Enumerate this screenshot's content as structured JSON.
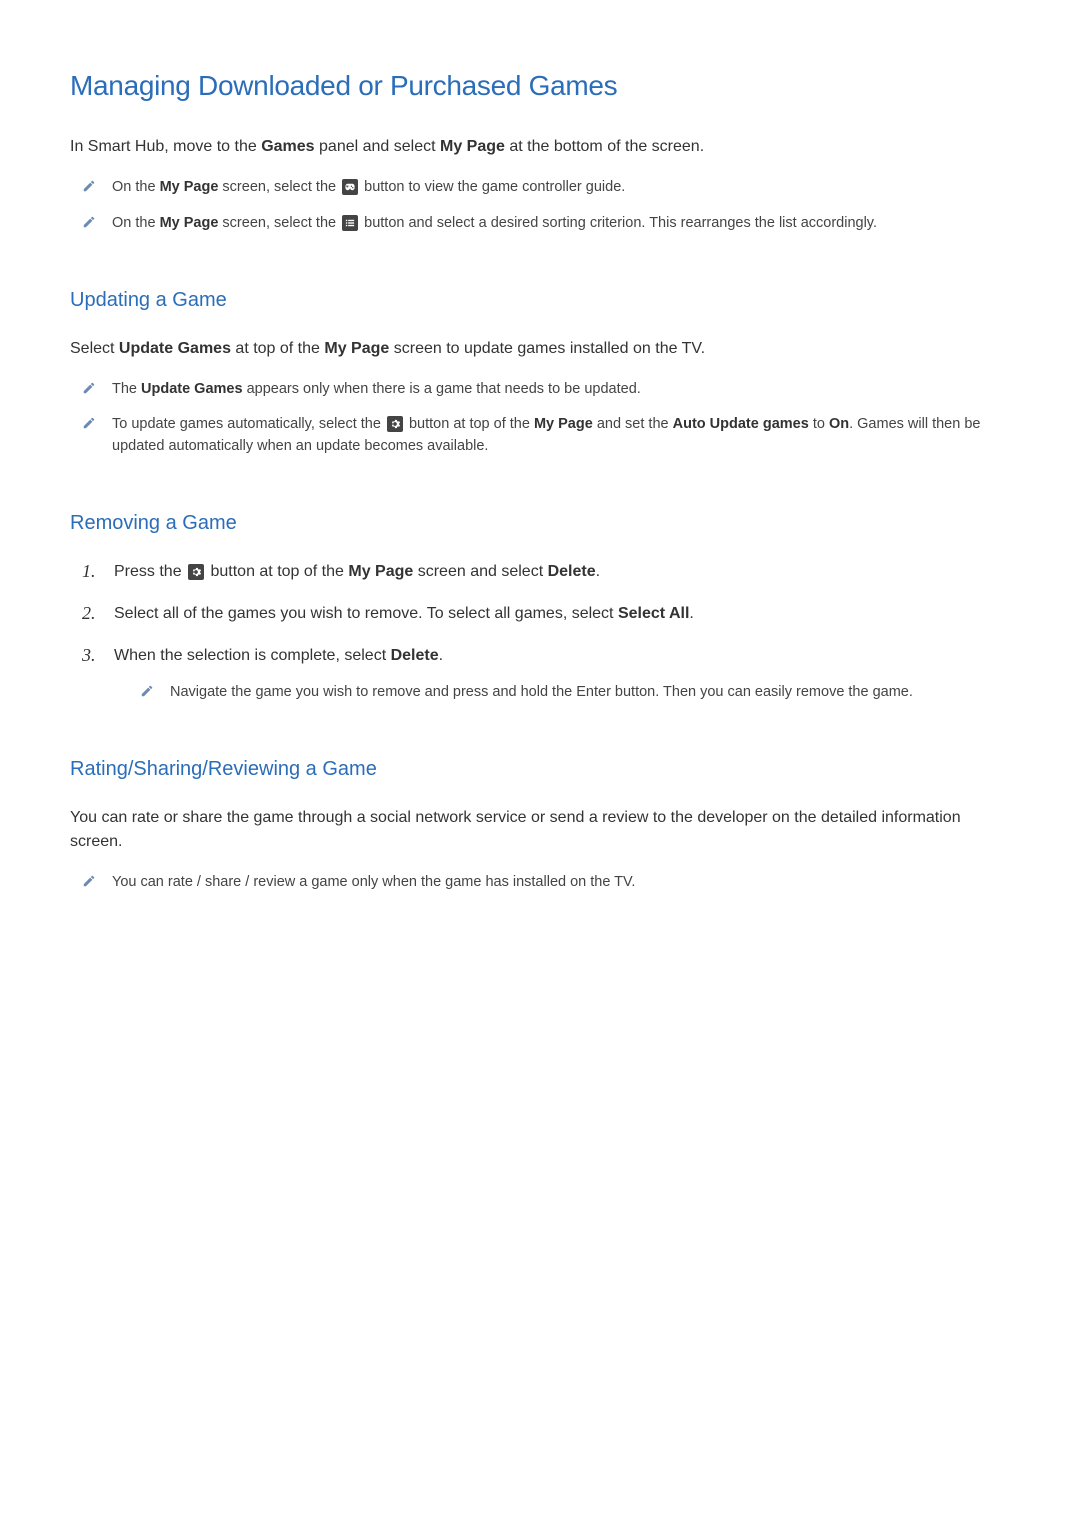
{
  "title": "Managing Downloaded or Purchased Games",
  "intro": {
    "p1a": "In Smart Hub, move to the ",
    "p1b": "Games",
    "p1c": " panel and select ",
    "p1d": "My Page",
    "p1e": " at the bottom of the screen."
  },
  "topNotes": {
    "n1a": "On the ",
    "n1b": "My Page",
    "n1c": " screen, select the ",
    "n1d": " button to view the game controller guide.",
    "n2a": "On the ",
    "n2b": "My Page",
    "n2c": " screen, select the ",
    "n2d": " button and select a desired sorting criterion. This rearranges the list accordingly."
  },
  "sec1": {
    "heading": "Updating a Game",
    "p1a": "Select ",
    "p1b": "Update Games",
    "p1c": " at top of the ",
    "p1d": "My Page",
    "p1e": " screen to update games installed on the TV.",
    "n1a": "The ",
    "n1b": "Update Games",
    "n1c": " appears only when there is a game that needs to be updated.",
    "n2a": "To update games automatically, select the ",
    "n2b": " button at top of the ",
    "n2c": "My Page",
    "n2d": " and set the ",
    "n2e": "Auto Update games",
    "n2f": " to ",
    "n2g": "On",
    "n2h": ". Games will then be updated automatically when an update becomes available."
  },
  "sec2": {
    "heading": "Removing a Game",
    "s1a": "Press the ",
    "s1b": " button at top of the ",
    "s1c": "My Page",
    "s1d": " screen and select ",
    "s1e": "Delete",
    "s1f": ".",
    "s2a": "Select all of the games you wish to remove. To select all games, select ",
    "s2b": "Select All",
    "s2c": ".",
    "s3a": "When the selection is complete, select ",
    "s3b": "Delete",
    "s3c": ".",
    "sub1": "Navigate the game you wish to remove and press and hold the Enter button. Then you can easily remove the game.",
    "num1": "1.",
    "num2": "2.",
    "num3": "3."
  },
  "sec3": {
    "heading": "Rating/Sharing/Reviewing a Game",
    "p1": "You can rate or share the game through a social network service or send a review to the developer on the detailed information screen.",
    "n1": "You can rate / share / review a game only when the game has installed on the TV."
  }
}
